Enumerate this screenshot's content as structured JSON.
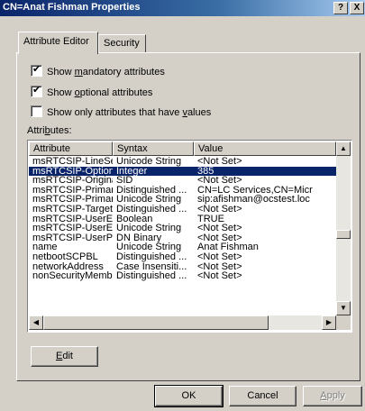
{
  "window": {
    "title": "CN=Anat Fishman Properties",
    "help_button": "?",
    "close_button": "X"
  },
  "tabs": [
    {
      "label": "Attribute Editor",
      "active": true
    },
    {
      "label": "Security",
      "active": false
    }
  ],
  "options": {
    "show_mandatory": {
      "prefix": "Show ",
      "accel": "m",
      "rest": "andatory attributes",
      "checked": true
    },
    "show_optional": {
      "prefix": "Show ",
      "accel": "o",
      "rest": "ptional attributes",
      "checked": true
    },
    "show_only_values": {
      "prefix": "Show only attributes that have ",
      "accel": "v",
      "rest": "alues",
      "checked": false
    }
  },
  "attributes_label": {
    "prefix": "Attri",
    "accel": "b",
    "rest": "utes:"
  },
  "table": {
    "columns": [
      "Attribute",
      "Syntax",
      "Value"
    ],
    "rows": [
      {
        "attribute": "msRTCSIP-LineServer",
        "syntax": "Unicode String",
        "value": "<Not Set>",
        "selected": false
      },
      {
        "attribute": "msRTCSIP-OptionFlags",
        "syntax": "Integer",
        "value": "385",
        "selected": true
      },
      {
        "attribute": "msRTCSIP-Originator...",
        "syntax": "SID",
        "value": "<Not Set>",
        "selected": false
      },
      {
        "attribute": "msRTCSIP-PrimaryHo...",
        "syntax": "Distinguished ...",
        "value": "CN=LC Services,CN=Micr",
        "selected": false
      },
      {
        "attribute": "msRTCSIP-PrimaryUs...",
        "syntax": "Unicode String",
        "value": "sip:afishman@ocstest.loc",
        "selected": false
      },
      {
        "attribute": "msRTCSIP-TargetHo...",
        "syntax": "Distinguished ...",
        "value": "<Not Set>",
        "selected": false
      },
      {
        "attribute": "msRTCSIP-UserEnab...",
        "syntax": "Boolean",
        "value": "TRUE",
        "selected": false
      },
      {
        "attribute": "msRTCSIP-UserExte...",
        "syntax": "Unicode String",
        "value": "<Not Set>",
        "selected": false
      },
      {
        "attribute": "msRTCSIP-UserPolicy",
        "syntax": "DN Binary",
        "value": "<Not Set>",
        "selected": false
      },
      {
        "attribute": "name",
        "syntax": "Unicode String",
        "value": "Anat Fishman",
        "selected": false
      },
      {
        "attribute": "netbootSCPBL",
        "syntax": "Distinguished ...",
        "value": "<Not Set>",
        "selected": false
      },
      {
        "attribute": "networkAddress",
        "syntax": "Case Insensiti...",
        "value": "<Not Set>",
        "selected": false
      },
      {
        "attribute": "nonSecurityMemberBL",
        "syntax": "Distinguished ...",
        "value": "<Not Set>",
        "selected": false
      }
    ]
  },
  "edit_button": {
    "accel": "E",
    "rest": "dit"
  },
  "footer": {
    "ok": "OK",
    "cancel": "Cancel",
    "apply": {
      "accel": "A",
      "rest": "pply"
    }
  }
}
